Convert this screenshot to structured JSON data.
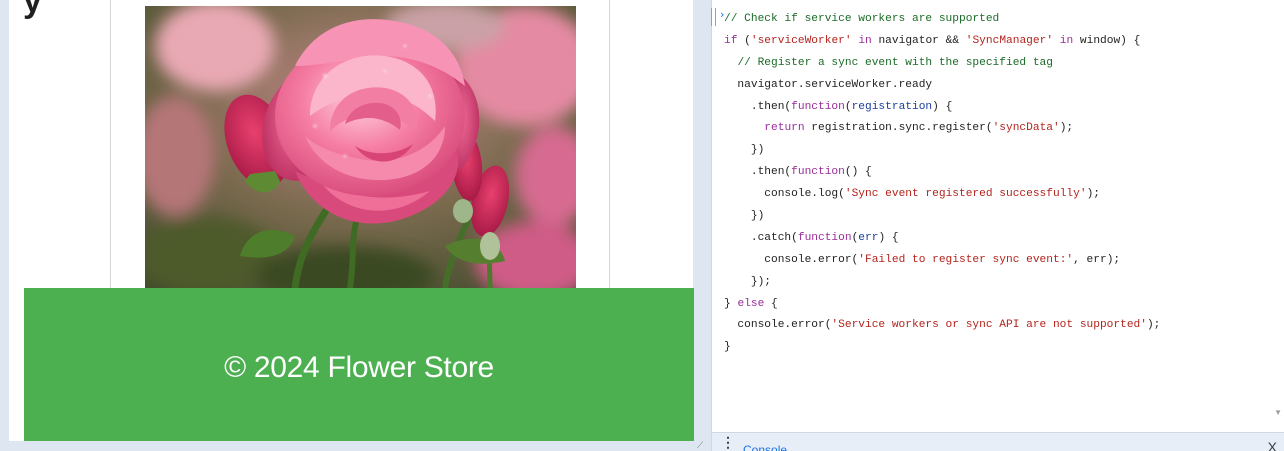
{
  "page": {
    "heading_fragment": "y",
    "footer_text": "© 2024 Flower Store"
  },
  "icons": {
    "rose_image": "rose-photo",
    "prompt": "chevron-right-icon",
    "menu": "kebab-menu-icon",
    "close": "close-icon"
  },
  "colors": {
    "footer_bg": "#4caf50",
    "footer_text": "#ffffff",
    "comment": "#1b6b28",
    "keyword": "#9a2d9a",
    "string": "#b4241e",
    "param": "#1b3fa0"
  },
  "console": {
    "prompt": "›",
    "lines": [
      [
        {
          "t": "cm",
          "v": "// Check if service workers are supported"
        }
      ],
      [
        {
          "t": "kw",
          "v": "if"
        },
        {
          "t": "",
          "v": " ("
        },
        {
          "t": "str",
          "v": "'serviceWorker'"
        },
        {
          "t": "",
          "v": " "
        },
        {
          "t": "kw",
          "v": "in"
        },
        {
          "t": "",
          "v": " navigator && "
        },
        {
          "t": "str",
          "v": "'SyncManager'"
        },
        {
          "t": "",
          "v": " "
        },
        {
          "t": "kw",
          "v": "in"
        },
        {
          "t": "",
          "v": " window) {"
        }
      ],
      [
        {
          "t": "",
          "v": "  "
        },
        {
          "t": "cm",
          "v": "// Register a sync event with the specified tag"
        }
      ],
      [
        {
          "t": "",
          "v": "  navigator.serviceWorker.ready"
        }
      ],
      [
        {
          "t": "",
          "v": "    .then("
        },
        {
          "t": "kw",
          "v": "function"
        },
        {
          "t": "",
          "v": "("
        },
        {
          "t": "var",
          "v": "registration"
        },
        {
          "t": "",
          "v": ") {"
        }
      ],
      [
        {
          "t": "",
          "v": "      "
        },
        {
          "t": "kw",
          "v": "return"
        },
        {
          "t": "",
          "v": " registration.sync.register("
        },
        {
          "t": "str",
          "v": "'syncData'"
        },
        {
          "t": "",
          "v": ");"
        }
      ],
      [
        {
          "t": "",
          "v": "    })"
        }
      ],
      [
        {
          "t": "",
          "v": "    .then("
        },
        {
          "t": "kw",
          "v": "function"
        },
        {
          "t": "",
          "v": "() {"
        }
      ],
      [
        {
          "t": "",
          "v": "      console.log("
        },
        {
          "t": "str",
          "v": "'Sync event registered successfully'"
        },
        {
          "t": "",
          "v": ");"
        }
      ],
      [
        {
          "t": "",
          "v": "    })"
        }
      ],
      [
        {
          "t": "",
          "v": "    .catch("
        },
        {
          "t": "kw",
          "v": "function"
        },
        {
          "t": "",
          "v": "("
        },
        {
          "t": "var",
          "v": "err"
        },
        {
          "t": "",
          "v": ") {"
        }
      ],
      [
        {
          "t": "",
          "v": "      console.error("
        },
        {
          "t": "str",
          "v": "'Failed to register sync event:'"
        },
        {
          "t": "",
          "v": ", err);"
        }
      ],
      [
        {
          "t": "",
          "v": "    });"
        }
      ],
      [
        {
          "t": "",
          "v": "} "
        },
        {
          "t": "kw",
          "v": "else"
        },
        {
          "t": "",
          "v": " {"
        }
      ],
      [
        {
          "t": "",
          "v": "  console.error("
        },
        {
          "t": "str",
          "v": "'Service workers or sync API are not supported'"
        },
        {
          "t": "",
          "v": ");"
        }
      ],
      [
        {
          "t": "",
          "v": "}"
        }
      ]
    ]
  },
  "drawer": {
    "menu_glyph": "⋮",
    "tab_label": "Console",
    "close_glyph": "X"
  }
}
